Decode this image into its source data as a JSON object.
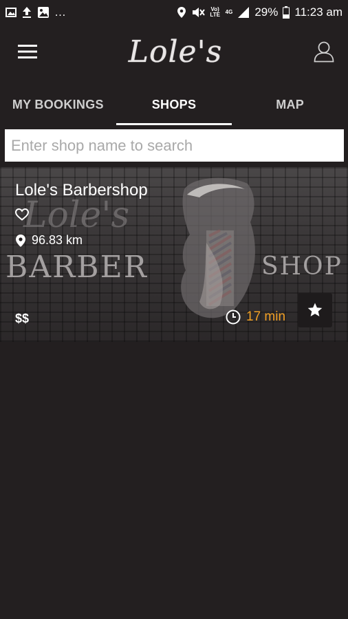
{
  "status_bar": {
    "battery": "29%",
    "time": "11:23 am",
    "volte_label": "Vo) LTE",
    "network": "4G"
  },
  "app_bar": {
    "logo_text": "Lole's"
  },
  "tabs": [
    {
      "label": "MY BOOKINGS",
      "active": false
    },
    {
      "label": "SHOPS",
      "active": true
    },
    {
      "label": "MAP",
      "active": false
    }
  ],
  "search": {
    "placeholder": "Enter shop name to search",
    "value": ""
  },
  "shops": [
    {
      "name": "Lole's Barbershop",
      "distance": "96.83 km",
      "price": "$$",
      "wait": "17 min",
      "sign_script": "Lole's",
      "sign_left": "BARBER",
      "sign_right": "SHOP"
    }
  ],
  "colors": {
    "background": "#231f20",
    "accent_wait": "#f2a024"
  }
}
